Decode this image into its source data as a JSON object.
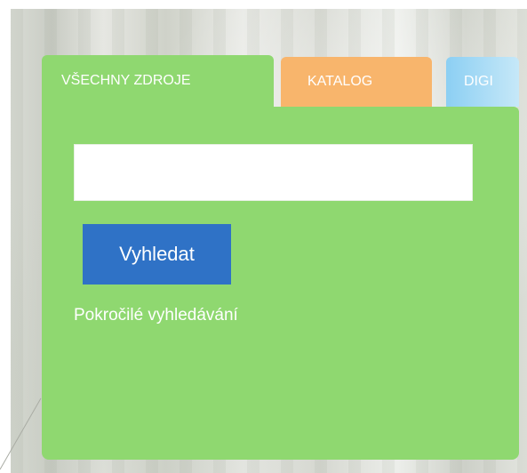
{
  "tabs": [
    {
      "label": "VŠECHNY ZDROJE",
      "color": "#8fd870",
      "active": true
    },
    {
      "label": "KATALOG",
      "color": "#f8b56c",
      "active": false
    },
    {
      "label": "DIGI",
      "color": "#8ccff3",
      "active": false
    }
  ],
  "search": {
    "value": "",
    "placeholder": "",
    "button_label": "Vyhledat"
  },
  "advanced_link_label": "Pokročilé vyhledávání",
  "colors": {
    "panel": "#8fd870",
    "button": "#2f72c6"
  }
}
